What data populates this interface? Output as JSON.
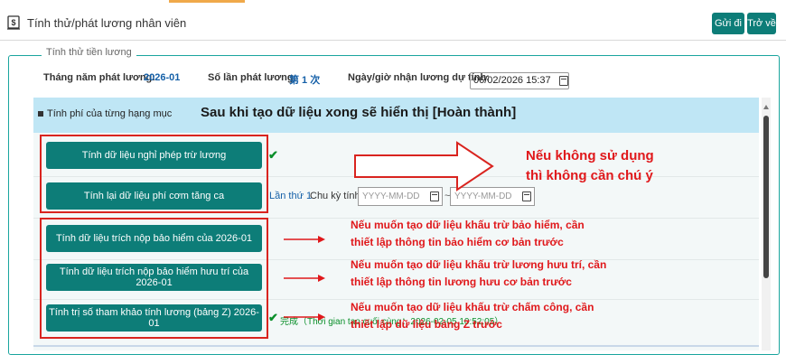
{
  "page": {
    "title": "Tính thử/phát lương nhân viên",
    "icon": "dollar-document-icon"
  },
  "header": {
    "send_label": "Gửi đi",
    "back_label": "Trở về"
  },
  "section": {
    "legend": "Tính thử tiền lương"
  },
  "info": {
    "month_label": "Tháng năm phát lương:",
    "month_value": "2026-01",
    "count_label": "Số lần phát lương:",
    "count_value": "第 1 次",
    "date_label": "Ngày/giờ nhận lương dự tính:",
    "date_value": "06/02/2026 15:37"
  },
  "band": {
    "label": "Tính phí của từng hạng mục",
    "note": "Sau khi tạo dữ liệu xong sẽ hiển thị [Hoàn thành]"
  },
  "rows": {
    "leave_btn": "Tính dữ liệu nghỉ phép trừ lương",
    "meal_btn": "Tính lại dữ liệu phí cơm tăng ca",
    "meal_times": "Lần thứ 1",
    "meal_period_label": "Chu kỳ tính",
    "date_placeholder": "YYYY-MM-DD",
    "range_sep": "~",
    "insurance_btn": "Tính dữ liệu trích nộp bảo hiểm của 2026-01",
    "pension_btn": "Tính dữ liệu trích nộp bảo hiểm hưu trí của 2026-01",
    "z_btn": "Tính trị số tham khảo tính lương (bảng Z) 2026-01",
    "z_status": "完成（Thời gian tạo cuối cùng：2026-02-05 10:52:05）"
  },
  "annotations": {
    "skip_line1": "Nếu không sử dụng",
    "skip_line2": "thì không cần chú ý",
    "ins_line1": "Nếu muốn tạo dữ liệu khấu trừ bảo hiểm, cần",
    "ins_line2": "thiết lập thông tin bảo hiểm cơ bản trước",
    "pen_line1": "Nếu muốn tạo dữ liệu khấu trừ lương hưu trí, cần",
    "pen_line2": "thiết lập thông tin lương hưu cơ bản trước",
    "z_line1": "Nếu muốn tạo dữ liệu khấu trừ chấm công, cần",
    "z_line2": "thiết lập dữ liệu bảng Z trước"
  },
  "colors": {
    "teal": "#0d7d78",
    "band": "#bfe6f5",
    "annotation_red": "#e0181b",
    "blue_text": "#1560a8"
  }
}
